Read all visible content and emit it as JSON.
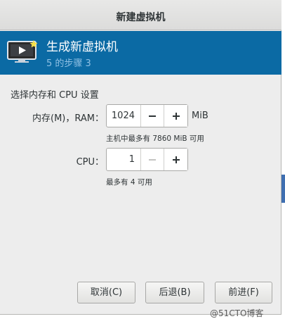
{
  "window": {
    "title": "新建虚拟机"
  },
  "banner": {
    "icon": "vm-monitor-icon",
    "title": "生成新虚拟机",
    "subtitle": "5 的步骤 3"
  },
  "form": {
    "section_title": "选择内存和 CPU 设置",
    "memory": {
      "label": "内存(M)，RAM：",
      "value": "1024",
      "unit": "MiB",
      "hint": "主机中最多有 7860 MiB 可用",
      "minus_icon": "minus-icon",
      "plus_icon": "plus-icon"
    },
    "cpu": {
      "label": "CPU：",
      "value": "1",
      "hint": "最多有 4 可用",
      "minus_icon": "minus-icon",
      "plus_icon": "plus-icon",
      "minus_disabled": true
    }
  },
  "footer": {
    "cancel_label": "取消(C)",
    "back_label": "后退(B)",
    "forward_label": "前进(F)"
  },
  "watermark": "@51CTO博客",
  "colors": {
    "banner_bg": "#0b6aa4",
    "banner_subtitle": "#8fc0e4",
    "dialog_bg": "#ededed"
  }
}
